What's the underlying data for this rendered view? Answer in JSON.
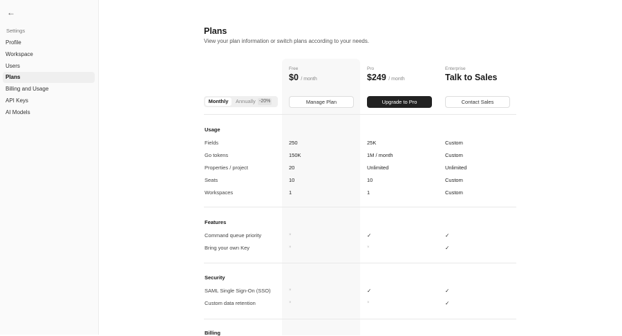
{
  "sidebar": {
    "back_icon": "arrow-left-icon",
    "section": "Settings",
    "items": [
      "Profile",
      "Workspace",
      "Users",
      "Plans",
      "Billing and Usage",
      "API Keys",
      "AI Models"
    ],
    "active": "Plans"
  },
  "header": {
    "title": "Plans",
    "subtitle": "View your plan information or switch plans according to your needs."
  },
  "billing_toggle": {
    "monthly": "Monthly",
    "annually": "Annually",
    "discount": "-20%",
    "selected": "Monthly"
  },
  "plans": [
    {
      "name": "Free",
      "price": "$0",
      "period": "/ month",
      "button": "Manage Plan"
    },
    {
      "name": "Pro",
      "price": "$249",
      "period": "/ month",
      "button": "Upgrade to Pro"
    },
    {
      "name": "Enterprise",
      "price": "Talk to Sales",
      "period": "",
      "button": "Contact Sales"
    }
  ],
  "sections": [
    {
      "title": "Usage",
      "rows": [
        {
          "label": "Fields",
          "values": [
            "250",
            "25K",
            "Custom"
          ]
        },
        {
          "label": "Go tokens",
          "values": [
            "150K",
            "1M / month",
            "Custom"
          ]
        },
        {
          "label": "Properties / project",
          "values": [
            "20",
            "Unlimited",
            "Unlimited"
          ]
        },
        {
          "label": "Seats",
          "values": [
            "10",
            "10",
            "Custom"
          ]
        },
        {
          "label": "Workspaces",
          "values": [
            "1",
            "1",
            "Custom"
          ]
        }
      ]
    },
    {
      "title": "Features",
      "rows": [
        {
          "label": "Command queue priority",
          "values": [
            "×",
            "✓",
            "✓"
          ]
        },
        {
          "label": "Bring your own Key",
          "values": [
            "×",
            "×",
            "✓"
          ]
        }
      ]
    },
    {
      "title": "Security",
      "rows": [
        {
          "label": "SAML Single Sign-On (SSO)",
          "values": [
            "×",
            "✓",
            "✓"
          ]
        },
        {
          "label": "Custom data retention",
          "values": [
            "×",
            "×",
            "✓"
          ]
        }
      ]
    },
    {
      "title": "Billing",
      "rows": []
    }
  ]
}
